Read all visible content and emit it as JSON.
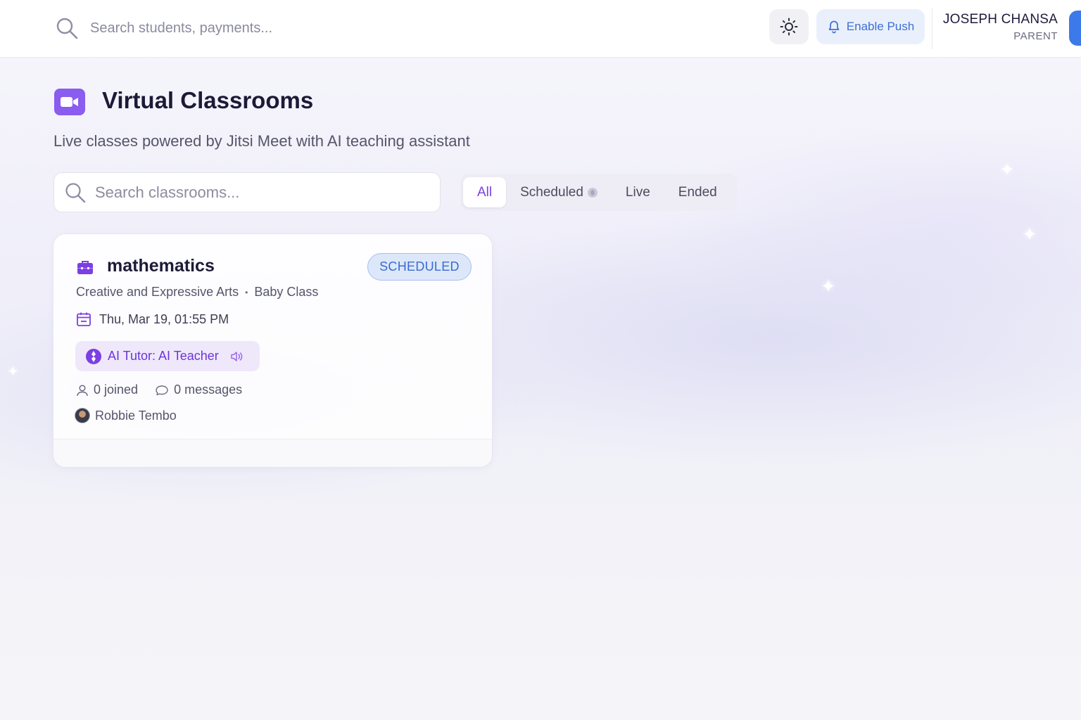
{
  "topbar": {
    "search_placeholder": "Search students, payments...",
    "enable_push_label": "Enable Push",
    "user_name": "JOSEPH CHANSA",
    "user_role": "PARENT"
  },
  "page": {
    "title": "Virtual Classrooms",
    "subtitle": "Live classes powered by Jitsi Meet with AI teaching assistant",
    "search_placeholder": "Search classrooms..."
  },
  "tabs": [
    {
      "label": "All",
      "active": true
    },
    {
      "label": "Scheduled",
      "active": false
    },
    {
      "label": "Live",
      "active": false
    },
    {
      "label": "Ended",
      "active": false
    }
  ],
  "classroom": {
    "title": "mathematics",
    "status": "SCHEDULED",
    "subject": "Creative and Expressive Arts",
    "separator": "•",
    "class_name": "Baby Class",
    "datetime": "Thu, Mar 19, 01:55 PM",
    "ai_tutor": "AI Tutor: AI Teacher",
    "joined": "0 joined",
    "messages": "0 messages",
    "teacher": "Robbie Tembo"
  },
  "colors": {
    "accent": "#7b3fe4",
    "status_blue": "#3a6bd0",
    "push_blue": "#3c6fd6"
  },
  "icons": [
    "search-icon",
    "sun-icon",
    "bell-icon",
    "video-camera-icon",
    "briefcase-icon",
    "calendar-icon",
    "ai-tutor-icon",
    "speaker-icon",
    "user-icon",
    "chat-icon"
  ]
}
